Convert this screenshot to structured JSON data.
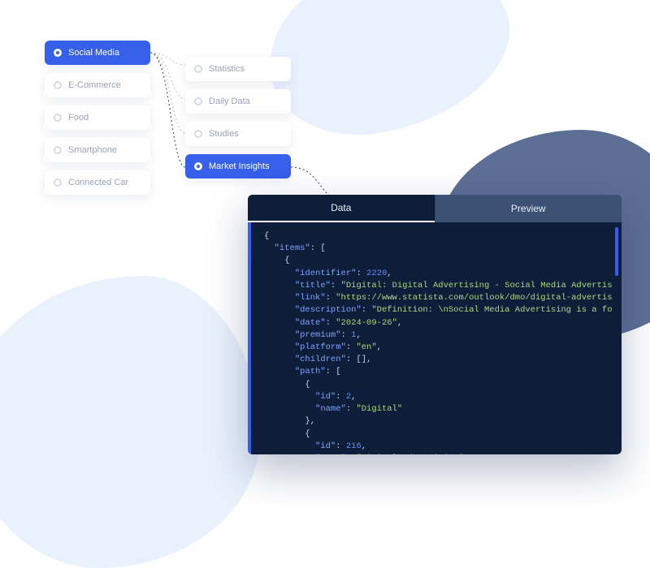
{
  "categories": {
    "left": [
      {
        "label": "Social Media",
        "active": true
      },
      {
        "label": "E-Commerce",
        "active": false
      },
      {
        "label": "Food",
        "active": false
      },
      {
        "label": "Smartphone",
        "active": false
      },
      {
        "label": "Connected Car",
        "active": false
      }
    ],
    "right": [
      {
        "label": "Statistics",
        "active": false
      },
      {
        "label": "Daily Data",
        "active": false
      },
      {
        "label": "Studies",
        "active": false
      },
      {
        "label": "Market Insights",
        "active": true
      }
    ]
  },
  "code_tabs": {
    "data": "Data",
    "preview": "Preview",
    "active": "data"
  },
  "response": {
    "items": [
      {
        "identifier": 2220,
        "title": "Digital: Digital Advertising - Social Media Advertis",
        "link": "https://www.statista.com/outlook/dmo/digital-advertis",
        "description": "Definition: \\nSocial Media Advertising is a fo",
        "date": "2024-09-26",
        "premium": 1,
        "platform": "en",
        "children": [],
        "path": [
          {
            "id": 2,
            "name": "Digital"
          },
          {
            "id": 216,
            "name": "Digital Advertising"
          }
        ]
      }
    ]
  }
}
